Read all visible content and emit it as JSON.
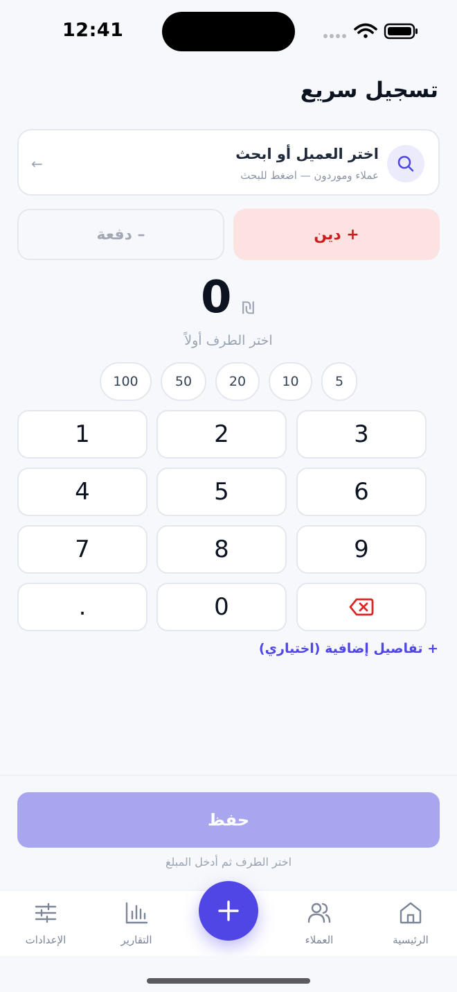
{
  "status_bar": {
    "time": "12:41",
    "icons": [
      "signal-icon",
      "wifi-icon",
      "battery-icon"
    ]
  },
  "page": {
    "title": "تسجيل سريع"
  },
  "search": {
    "title": "اختر العميل أو ابحث",
    "subtitle": "عملاء وموردون — اضغط للبحث",
    "arrow": "←"
  },
  "type_toggle": {
    "debt_label": "+ دين",
    "payment_label": "– دفعة",
    "selected": "debt",
    "debt_color": "#c81e1e",
    "debt_bg": "#fde2e2"
  },
  "amount": {
    "value": "0",
    "currency": "₪",
    "hint": "اختر الطرف أولاً"
  },
  "quick_amounts": [
    "100",
    "50",
    "20",
    "10",
    "5"
  ],
  "keypad": {
    "k1": "1",
    "k2": "2",
    "k3": "3",
    "k4": "4",
    "k5": "5",
    "k6": "6",
    "k7": "7",
    "k8": "8",
    "k9": "9",
    "dot": ".",
    "k0": "0",
    "backspace_icon": "backspace-icon"
  },
  "extra_details": "+ تفاصيل إضافية (اختياري)",
  "save": {
    "label": "حفظ",
    "hint": "اختر الطرف ثم أدخل المبلغ"
  },
  "tabs": {
    "settings": "الإعدادات",
    "reports": "التقارير",
    "customers": "العملاء",
    "home": "الرئيسية"
  },
  "colors": {
    "accent": "#4f46e5",
    "save_disabled": "#a9a6f0",
    "background": "#f7f8fb"
  }
}
